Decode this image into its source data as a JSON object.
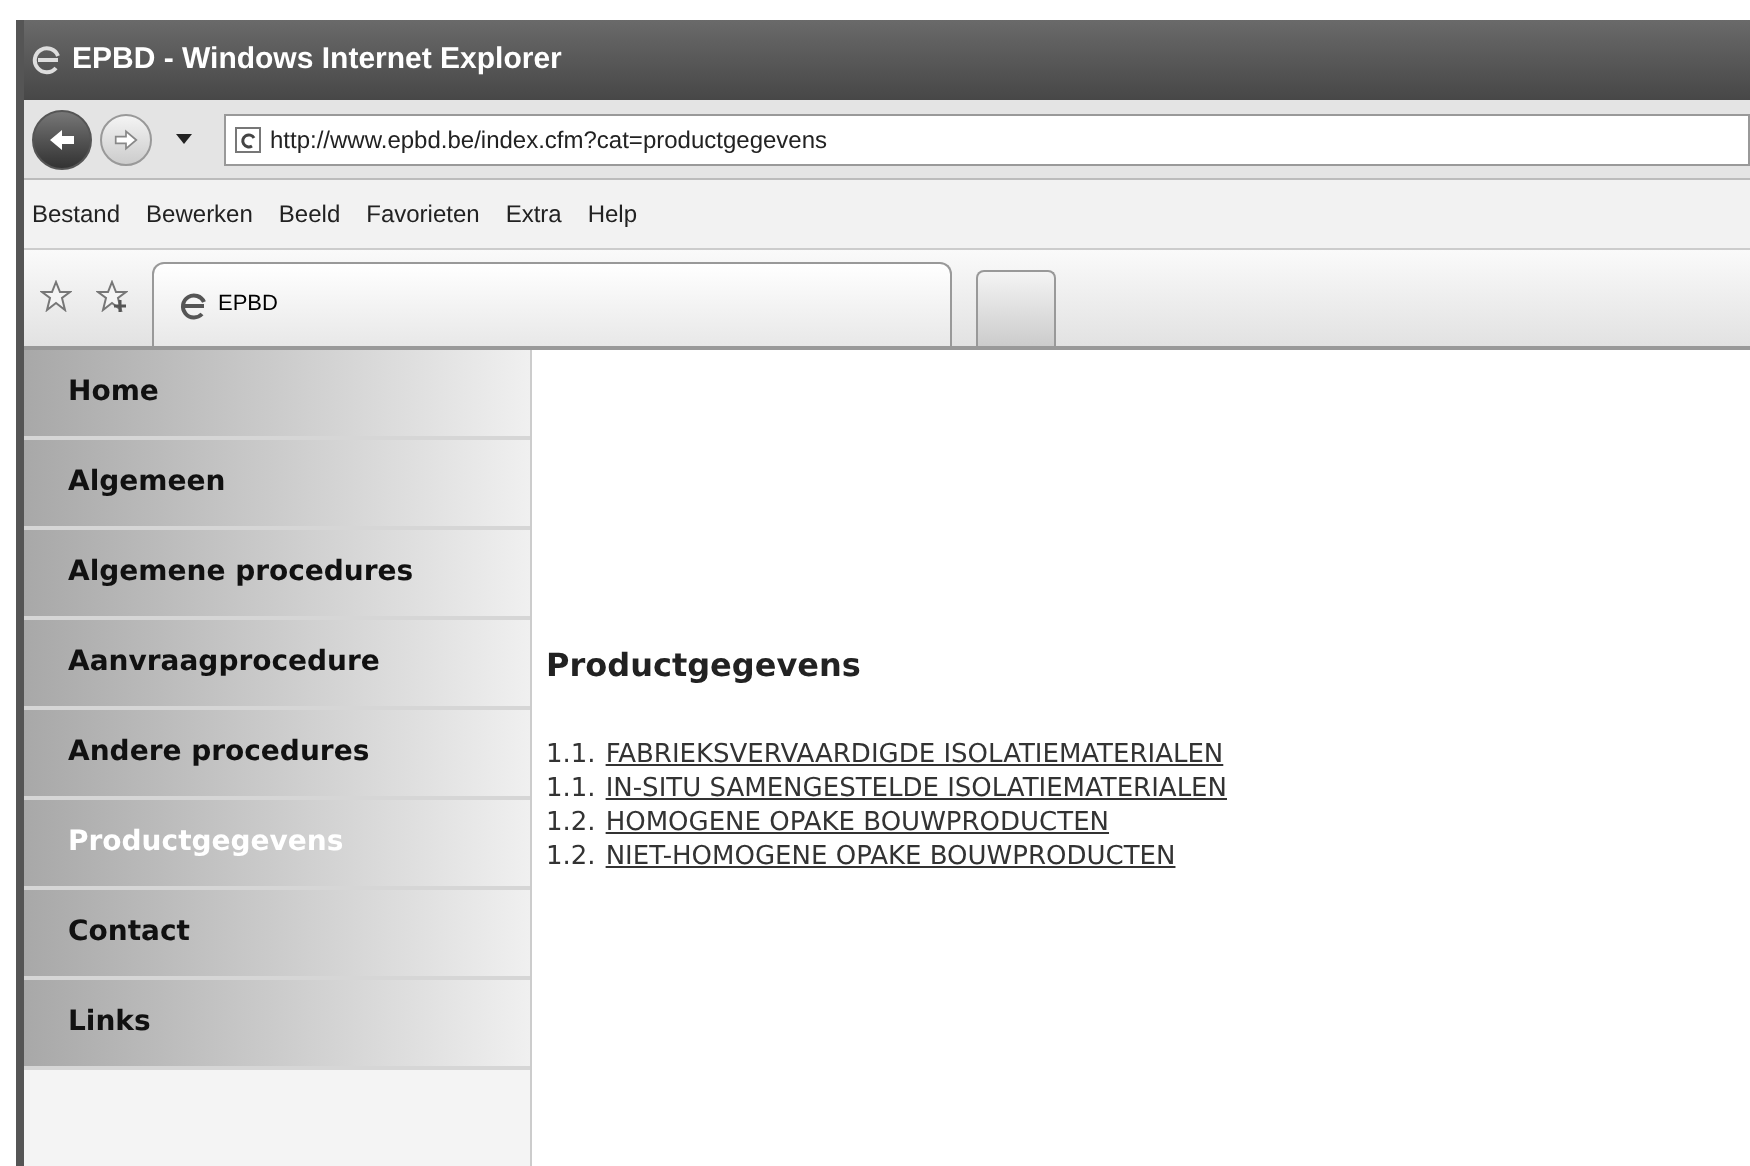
{
  "window": {
    "title": "EPBD - Windows Internet Explorer"
  },
  "address_bar": {
    "url": "http://www.epbd.be/index.cfm?cat=productgegevens"
  },
  "menu": [
    "Bestand",
    "Bewerken",
    "Beeld",
    "Favorieten",
    "Extra",
    "Help"
  ],
  "tabs": [
    {
      "label": "EPBD",
      "selected": true
    }
  ],
  "sidebar": {
    "items": [
      {
        "label": "Home",
        "selected": false
      },
      {
        "label": "Algemeen",
        "selected": false
      },
      {
        "label": "Algemene procedures",
        "selected": false
      },
      {
        "label": "Aanvraagprocedure",
        "selected": false
      },
      {
        "label": "Andere procedures",
        "selected": false
      },
      {
        "label": "Productgegevens",
        "selected": true
      },
      {
        "label": "Contact",
        "selected": false
      },
      {
        "label": "Links",
        "selected": false
      }
    ]
  },
  "content": {
    "heading": "Productgegevens",
    "links": [
      {
        "number": "1.1.",
        "label": "FABRIEKSVERVAARDIGDE ISOLATIEMATERIALEN"
      },
      {
        "number": "1.1.",
        "label": "IN-SITU SAMENGESTELDE ISOLATIEMATERIALEN"
      },
      {
        "number": "1.2.",
        "label": "HOMOGENE OPAKE BOUWPRODUCTEN"
      },
      {
        "number": "1.2.",
        "label": "NIET-HOMOGENE OPAKE BOUWPRODUCTEN"
      }
    ]
  }
}
